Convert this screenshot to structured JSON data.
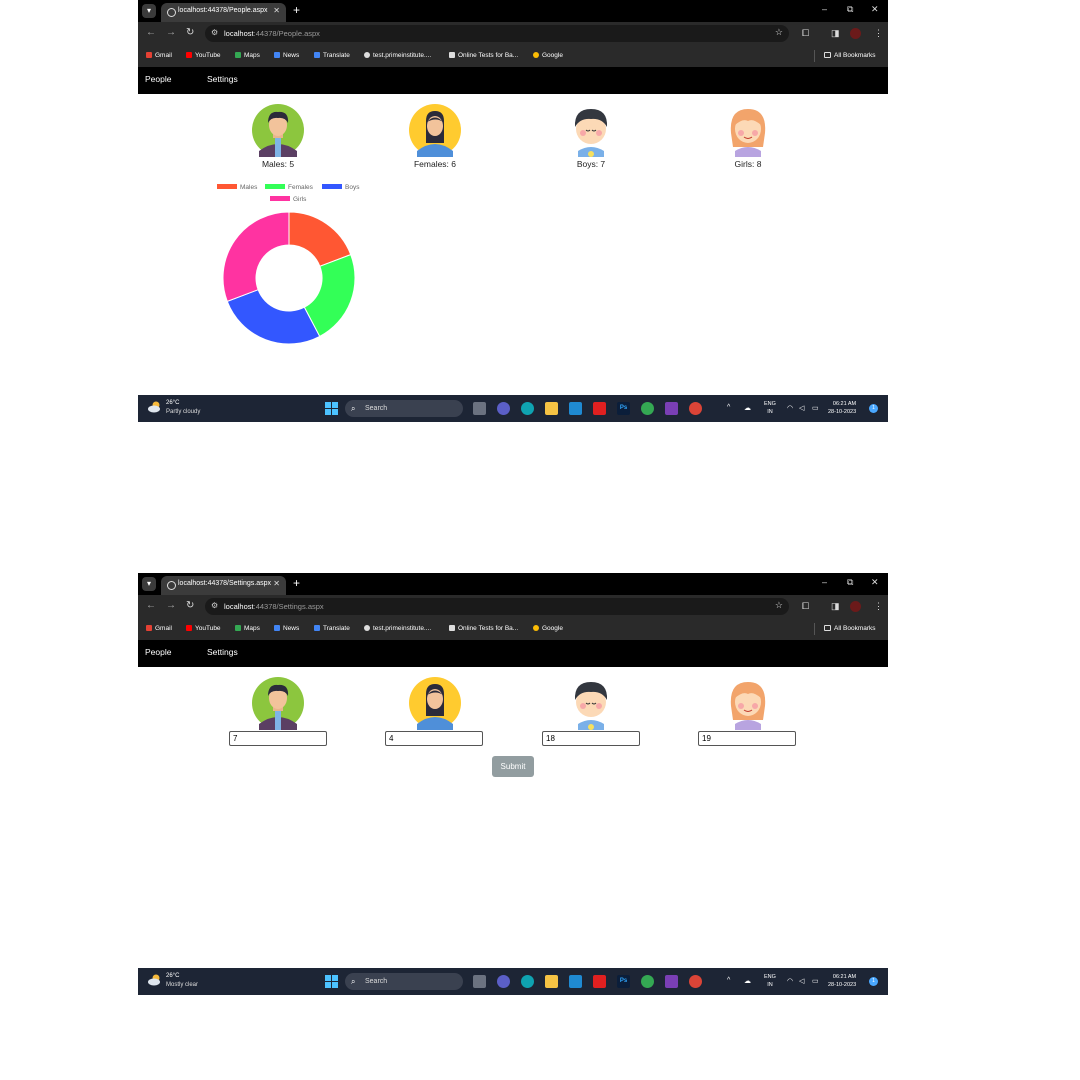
{
  "bookmarks": [
    {
      "label": "Gmail",
      "color": "#e44134"
    },
    {
      "label": "YouTube",
      "color": "#ff0000"
    },
    {
      "label": "Maps",
      "color": "#34a853"
    },
    {
      "label": "News",
      "color": "#4285f4"
    },
    {
      "label": "Translate",
      "color": "#4285f4"
    },
    {
      "label": "test.primeinstitute....",
      "color": "#dddddd"
    },
    {
      "label": "Online Tests for Ba...",
      "color": "#dddddd"
    },
    {
      "label": "Google",
      "color": "#fbbc05"
    }
  ],
  "all_bookmarks_label": "All Bookmarks",
  "nav": {
    "people": "People",
    "settings": "Settings"
  },
  "people_page": {
    "tab_title": "localhost:44378/People.aspx",
    "address_host": "localhost",
    "address_path": ":44378/People.aspx",
    "labels": [
      "Males: 5",
      "Females: 6",
      "Boys: 7",
      "Girls: 8"
    ]
  },
  "settings_page": {
    "tab_title": "localhost:44378/Settings.aspx",
    "address_host": "localhost",
    "address_path": ":44378/Settings.aspx",
    "inputs": [
      "7",
      "4",
      "18",
      "19"
    ],
    "submit_label": "Submit"
  },
  "taskbar_people": {
    "temp": "26°C",
    "weather": "Partly cloudy",
    "search": "Search",
    "lang1": "ENG",
    "lang2": "IN",
    "time": "06:21 AM",
    "date": "28-10-2023"
  },
  "taskbar_settings": {
    "temp": "26°C",
    "weather": "Mostly clear",
    "search": "Search",
    "lang1": "ENG",
    "lang2": "IN",
    "time": "06:21 AM",
    "date": "28-10-2023"
  },
  "chart_data": {
    "type": "pie",
    "categories": [
      "Males",
      "Females",
      "Boys",
      "Girls"
    ],
    "values": [
      5,
      6,
      7,
      8
    ],
    "colors": [
      "#ff5733",
      "#33ff57",
      "#3357ff",
      "#ff33a1"
    ],
    "legend": "top"
  }
}
